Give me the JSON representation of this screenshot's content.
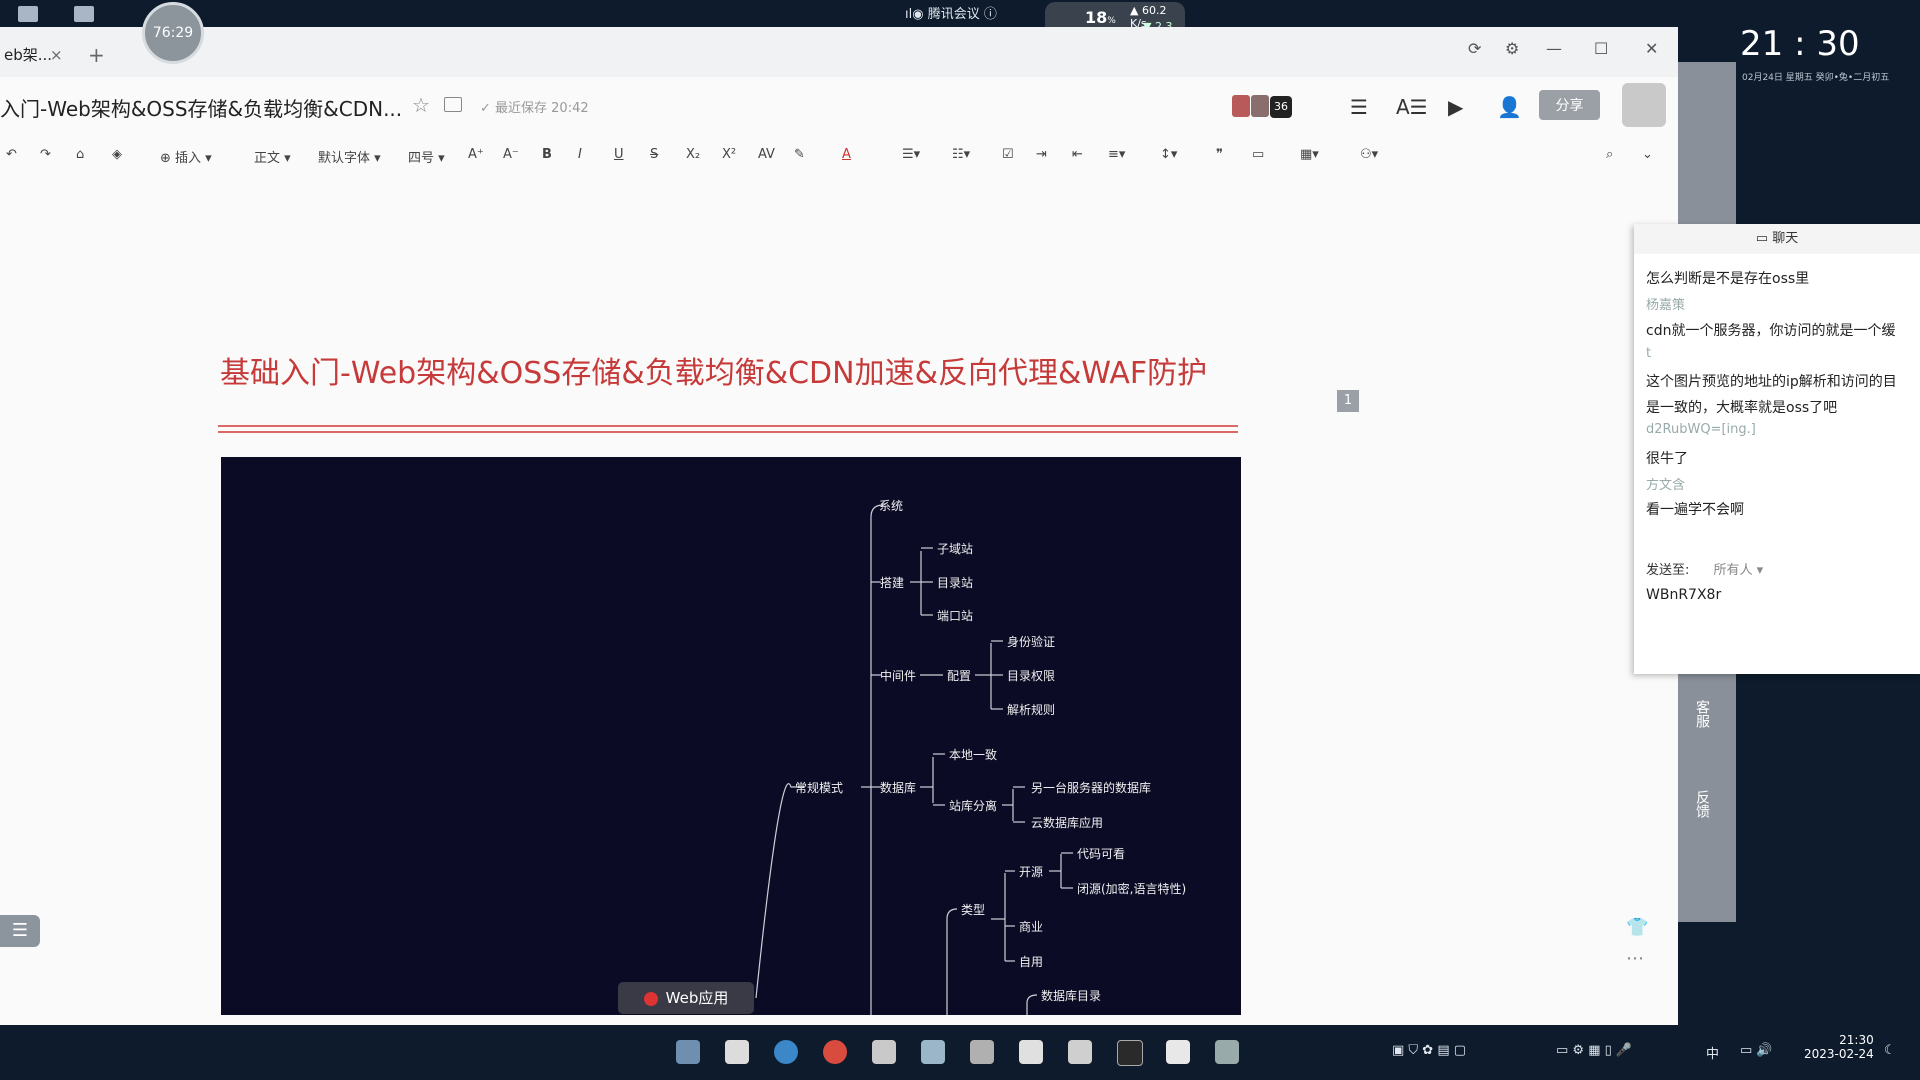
{
  "desktop": {
    "meeting_label": "腾讯会议",
    "timer": "76:29",
    "cpu_percent": "18",
    "cpu_unit": "%",
    "net_up": "60.2 K/s",
    "net_down": "2.3 K/s",
    "clock": "21 : 30",
    "clock_date": "02月24日  星期五  癸卯•兔•二月初五"
  },
  "window": {
    "tab_label": "eb架...",
    "tab_close": "×",
    "tab_add": "+",
    "doc_title": "入门-Web架构&OSS存储&负载均衡&CDN...",
    "save_status": "最近保存 20:42",
    "collab_count": "36",
    "share_label": "分享"
  },
  "toolbar": {
    "insert": "插入",
    "style": "正文",
    "font": "默认字体",
    "size": "四号"
  },
  "document": {
    "heading": "基础入门-Web架构&OSS存储&负载均衡&CDN加速&反向代理&WAF防护",
    "page_badge": "1"
  },
  "mindmap": {
    "root": "Web应用",
    "normal_mode": "常规模式",
    "system": "系统",
    "build": "搭建",
    "subdomain": "子域站",
    "dir_site": "目录站",
    "port_site": "端口站",
    "middleware": "中间件",
    "config": "配置",
    "auth": "身份验证",
    "dir_perm": "目录权限",
    "parse_rule": "解析规则",
    "database": "数据库",
    "local": "本地一致",
    "separate": "站库分离",
    "other_db": "另一台服务器的数据库",
    "cloud_db": "云数据库应用",
    "type": "类型",
    "open_source": "开源",
    "code_visible": "代码可看",
    "closed_source": "闭源(加密,语言特性)",
    "commercial": "商业",
    "self_use": "自用",
    "db_dir": "数据库目录"
  },
  "chat": {
    "title": "聊天",
    "messages": [
      {
        "text": "怎么判断是不是存在oss里",
        "sender": false
      },
      {
        "text": "杨嘉策",
        "sender": true
      },
      {
        "text": "cdn就一个服务器，你访问的就是一个缓",
        "sender": false
      },
      {
        "text": "t",
        "sender": true
      },
      {
        "text": "这个图片预览的地址的ip解析和访问的目",
        "sender": false
      },
      {
        "text": "是一致的，大概率就是oss了吧",
        "sender": false
      },
      {
        "text": "d2RubWQ=[ing.]",
        "sender": true
      },
      {
        "text": "很牛了",
        "sender": false
      },
      {
        "text": "方文含",
        "sender": true
      },
      {
        "text": "看一遍学不会啊",
        "sender": false
      }
    ],
    "send_to_label": "发送至:",
    "send_target": "所有人 ▾",
    "input_value": "WBnR7X8r"
  },
  "side": {
    "service": "客服",
    "feedback": "反馈"
  },
  "taskbar": {
    "time": "21:30",
    "date": "2023-02-24",
    "ime": "中"
  },
  "colors": {
    "heading_red": "#c63a3a",
    "mindmap_bg": "#0b0b26",
    "taskbar_bg": "#0d1b2c"
  }
}
